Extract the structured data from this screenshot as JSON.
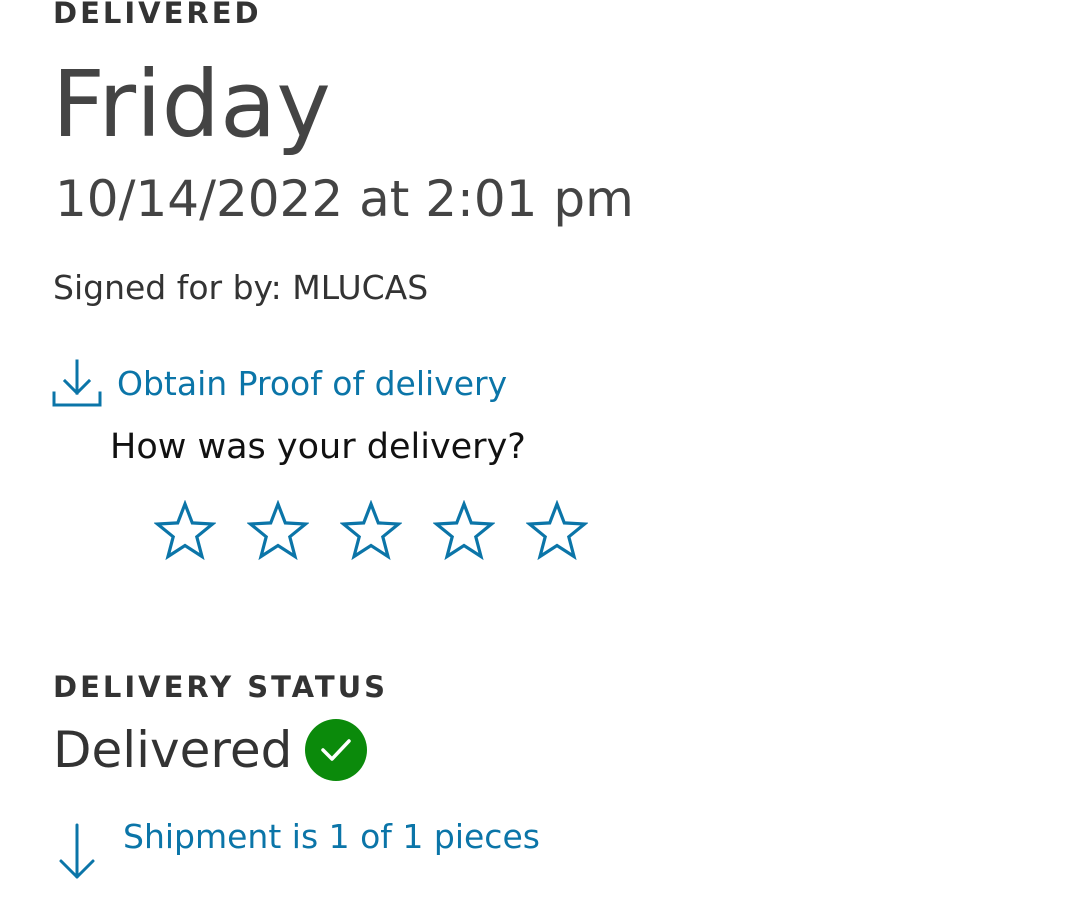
{
  "delivery": {
    "eyebrow": "DELIVERED",
    "day": "Friday",
    "datetime": "10/14/2022 at 2:01 pm",
    "signed_for": "Signed for by: MLUCAS"
  },
  "proof_link": {
    "label": "Obtain Proof of delivery",
    "icon": "download-icon"
  },
  "rating": {
    "question": "How was your delivery?",
    "max_stars": 5,
    "selected": 0,
    "icon": "star-outline-icon"
  },
  "status": {
    "eyebrow": "DELIVERY STATUS",
    "value": "Delivered",
    "icon": "check-circle-icon",
    "icon_color": "#0b8a0b"
  },
  "pieces_link": {
    "label": "Shipment is 1 of 1 pieces",
    "icon": "arrow-down-icon"
  },
  "colors": {
    "link": "#0b75a8",
    "text": "#333333",
    "success": "#0b8a0b"
  }
}
